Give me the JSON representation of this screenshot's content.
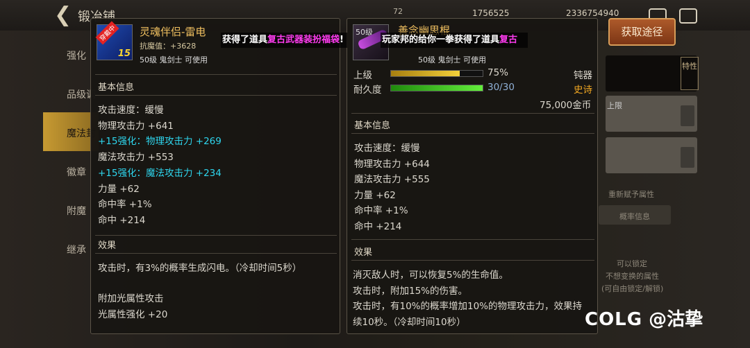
{
  "topbar": {
    "title": "锻冶铺",
    "small_num": "72",
    "num1": "1756525",
    "num2": "2336754940"
  },
  "side_menu": [
    "强化",
    "品级调",
    "魔法封",
    "徽章",
    "附魔",
    "继承"
  ],
  "get_button": "获取途径",
  "right_panel": {
    "tab": "特性",
    "box2_label": "上限",
    "label1": "重新赋予属性",
    "label2": "概率信息",
    "label3": "可以锁定",
    "label4": "不想变换的属性",
    "label5": "(可自由锁定/解锁)"
  },
  "left_item": {
    "name": "灵魂伴侣-雷电",
    "badge": "穿戴中",
    "level_badge": "15",
    "resist": "抗魔值：+3628",
    "req": "50级 鬼剑士 可使用",
    "basic_title": "基本信息",
    "stats": [
      {
        "text": "攻击速度：缓慢",
        "cyan": false
      },
      {
        "text": "物理攻击力 +641",
        "cyan": false
      },
      {
        "text": "+15强化：物理攻击力 +269",
        "cyan": true
      },
      {
        "text": "魔法攻击力 +553",
        "cyan": false
      },
      {
        "text": "+15强化：魔法攻击力 +234",
        "cyan": true
      },
      {
        "text": "力量 +62",
        "cyan": false
      },
      {
        "text": "命中率 +1%",
        "cyan": false
      },
      {
        "text": "命中 +214",
        "cyan": false
      }
    ],
    "effect_title": "效果",
    "effect1": "攻击时，有3%的概率生成闪电。（冷却时间5秒）",
    "effect2": "附加光属性攻击",
    "effect3": "光属性强化 +20"
  },
  "right_item": {
    "icon_level": "50级",
    "name": "善念幽思棍",
    "req": "50级 鬼剑士 可使用",
    "grade_label": "上级",
    "grade_value": "75%",
    "grade_fraction": 0.75,
    "durability_label": "耐久度",
    "durability_value": "30/30",
    "durability_fraction": 1.0,
    "type": "钝器",
    "rarity": "史诗",
    "price": "75,000金币",
    "basic_title": "基本信息",
    "stats": [
      "攻击速度：缓慢",
      "物理攻击力 +644",
      "魔法攻击力 +555",
      "力量 +62",
      "命中率 +1%",
      "命中 +214"
    ],
    "effect_title": "效果",
    "effects": [
      "消灭敌人时，可以恢复5%的生命值。",
      "攻击时，附加15%的伤害。",
      "攻击时，有10%的概率增加10%的物理攻击力，效果持",
      "续10秒。（冷却时间10秒）"
    ]
  },
  "ticker1": {
    "pre": "获得了道具",
    "hl": "复古武器装扮福袋",
    "post": "!"
  },
  "ticker2": {
    "pre": "玩家邦的给你一拳获得了道具",
    "hl": "复古"
  },
  "watermark": {
    "logo": "COLG",
    "name": "@沽挚"
  },
  "colors": {
    "gold": "#f0c060",
    "cyan": "#2ed6ee",
    "magenta": "#ff3cf0",
    "grade_bar": "#e8c21c",
    "durability_bar": "#3ed414"
  }
}
